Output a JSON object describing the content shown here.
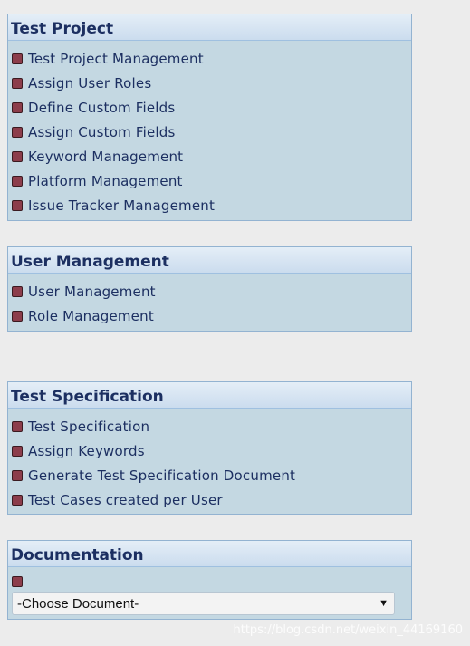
{
  "panels": {
    "test_project": {
      "title": "Test Project",
      "items": [
        "Test Project Management",
        "Assign User Roles",
        "Define Custom Fields",
        "Assign Custom Fields",
        "Keyword Management",
        "Platform Management",
        "Issue Tracker Management"
      ]
    },
    "user_management": {
      "title": "User Management",
      "items": [
        "User Management",
        "Role Management"
      ]
    },
    "test_specification": {
      "title": "Test Specification",
      "items": [
        "Test Specification",
        "Assign Keywords",
        "Generate Test Specification Document",
        "Test Cases created per User"
      ]
    },
    "documentation": {
      "title": "Documentation",
      "select_value": "-Choose Document-"
    }
  },
  "watermark": "https://blog.csdn.net/weixin_44169160",
  "colors": {
    "page_bg": "#ececec",
    "panel_bg": "#c4d8e2",
    "panel_border": "#93b3d1",
    "title_text": "#1c2f61",
    "bullet": "#8c3d4b"
  },
  "icons": {
    "bullet": "bullet-icon",
    "dropdown": "chevron-down-icon"
  }
}
